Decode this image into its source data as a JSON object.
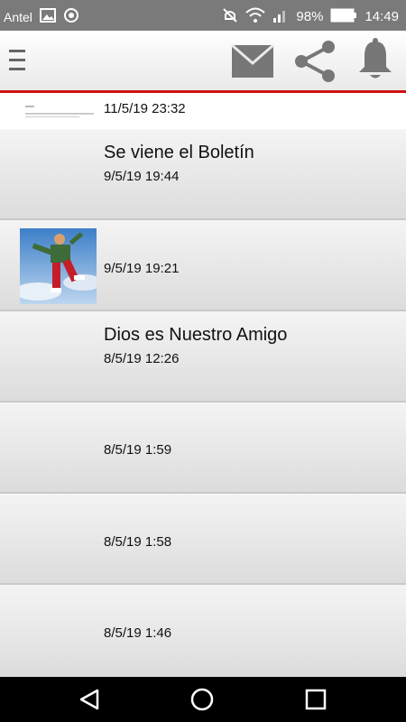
{
  "status_bar": {
    "carrier": "Antel",
    "battery": "98%",
    "time": "14:49",
    "icons": [
      "image-icon",
      "location-icon",
      "mute-icon",
      "wifi-icon",
      "signal-icon",
      "battery-icon"
    ]
  },
  "app_bar": {
    "icons": [
      "menu-icon",
      "mail-icon",
      "share-icon",
      "bell-icon"
    ],
    "accent_color": "#cc1111"
  },
  "items": [
    {
      "title": "",
      "date": "11/5/19 23:32",
      "thumbnail": "document-thumbnail"
    },
    {
      "title": "Se viene el Boletín",
      "date": "9/5/19 19:44"
    },
    {
      "title": "",
      "date": "9/5/19 19:21",
      "thumbnail": "photo-thumbnail"
    },
    {
      "title": "Dios es Nuestro Amigo",
      "date": "8/5/19 12:26"
    },
    {
      "title": "",
      "date": "8/5/19 1:59"
    },
    {
      "title": "",
      "date": "8/5/19 1:58"
    },
    {
      "title": "",
      "date": "8/5/19 1:46"
    }
  ],
  "nav_bar": {
    "icons": [
      "back-icon",
      "home-icon",
      "recents-icon"
    ]
  }
}
